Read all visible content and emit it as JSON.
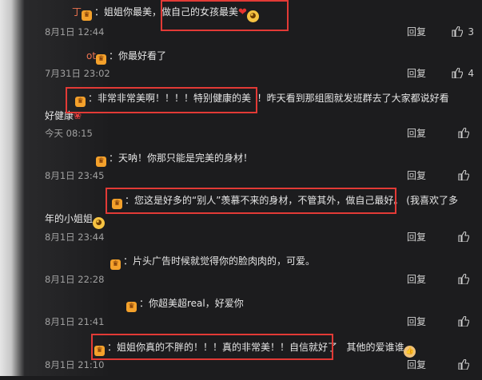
{
  "comments": [
    {
      "prefix": "丁",
      "text": "：姐姐你最美，",
      "highlight": "做自己的女孩最美",
      "time": "8月1日 12:44",
      "reply": "回复",
      "likes": "3"
    },
    {
      "prefix": "ot",
      "text": "：你最好看了",
      "time": "7月31日 23:02",
      "reply": "回复",
      "likes": "4"
    },
    {
      "highlight": "：非常非常美啊！！！！特别健康的美",
      "text_after": "！昨天看到那组图就发班群去了大家都说好看",
      "text_line2": "好健康",
      "time": "今天 08:15",
      "reply": "回复",
      "likes": ""
    },
    {
      "text": "：天呐！你那只能是完美的身材！",
      "time": "8月1日 23:45",
      "reply": "回复",
      "likes": ""
    },
    {
      "highlight": "：您这是好多的“别人”羡慕不来的身材，不管其外，做自己最好。",
      "text_after": "(我喜欢了多",
      "text_line2": "年的小姐姐",
      "time": "8月1日 23:44",
      "reply": "回复",
      "likes": ""
    },
    {
      "text": "：片头广告时候就觉得你的脸肉肉的，可爱。",
      "time": "8月1日 22:28",
      "reply": "回复",
      "likes": ""
    },
    {
      "text": "：你超美超real，好爱你",
      "time": "8月1日 21:41",
      "reply": "回复",
      "likes": ""
    },
    {
      "highlight": "：姐姐你真的不胖的！！！真的非常美！！自信就好了",
      "text_after": "其他的爱谁谁",
      "time": "8月1日 21:10",
      "reply": "回复",
      "likes": ""
    }
  ]
}
